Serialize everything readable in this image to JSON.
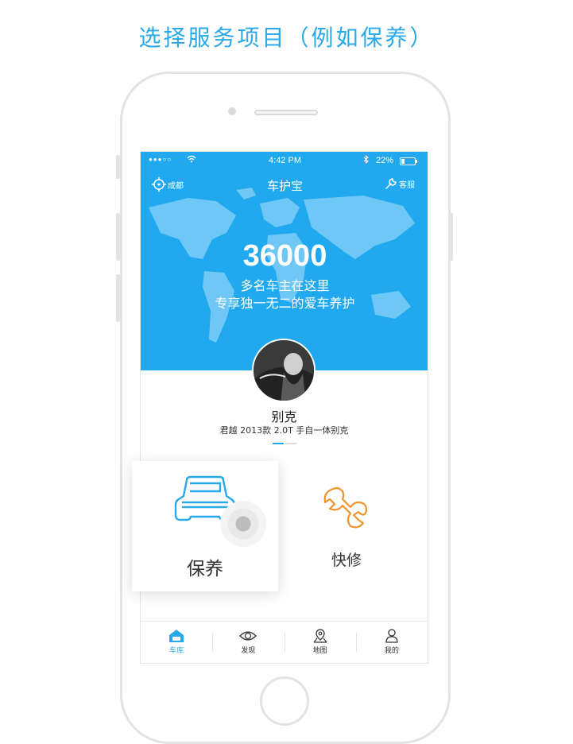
{
  "caption": "选择服务项目（例如保养）",
  "status_bar": {
    "signal": "●●●○○",
    "time": "4:42 PM",
    "battery": "22%"
  },
  "nav": {
    "location": "成都",
    "title": "车护宝",
    "service": "客服"
  },
  "hero": {
    "number": "36000",
    "line1": "多名车主在这里",
    "line2": "专享独一无二的爱车养护"
  },
  "car": {
    "name": "别克",
    "model": "君越 2013款 2.0T 手自一体别克"
  },
  "services": [
    {
      "label": "保养",
      "icon": "car-icon",
      "color": "#2aa9ea"
    },
    {
      "label": "快修",
      "icon": "wrench-icon",
      "color": "#f0932b"
    }
  ],
  "tabs": [
    {
      "label": "车库",
      "icon": "garage-icon",
      "active": true
    },
    {
      "label": "发现",
      "icon": "eye-icon",
      "active": false
    },
    {
      "label": "地图",
      "icon": "map-pin-icon",
      "active": false
    },
    {
      "label": "我的",
      "icon": "user-icon",
      "active": false
    }
  ],
  "colors": {
    "accent": "#21a9f0",
    "quick_repair": "#f0932b"
  }
}
